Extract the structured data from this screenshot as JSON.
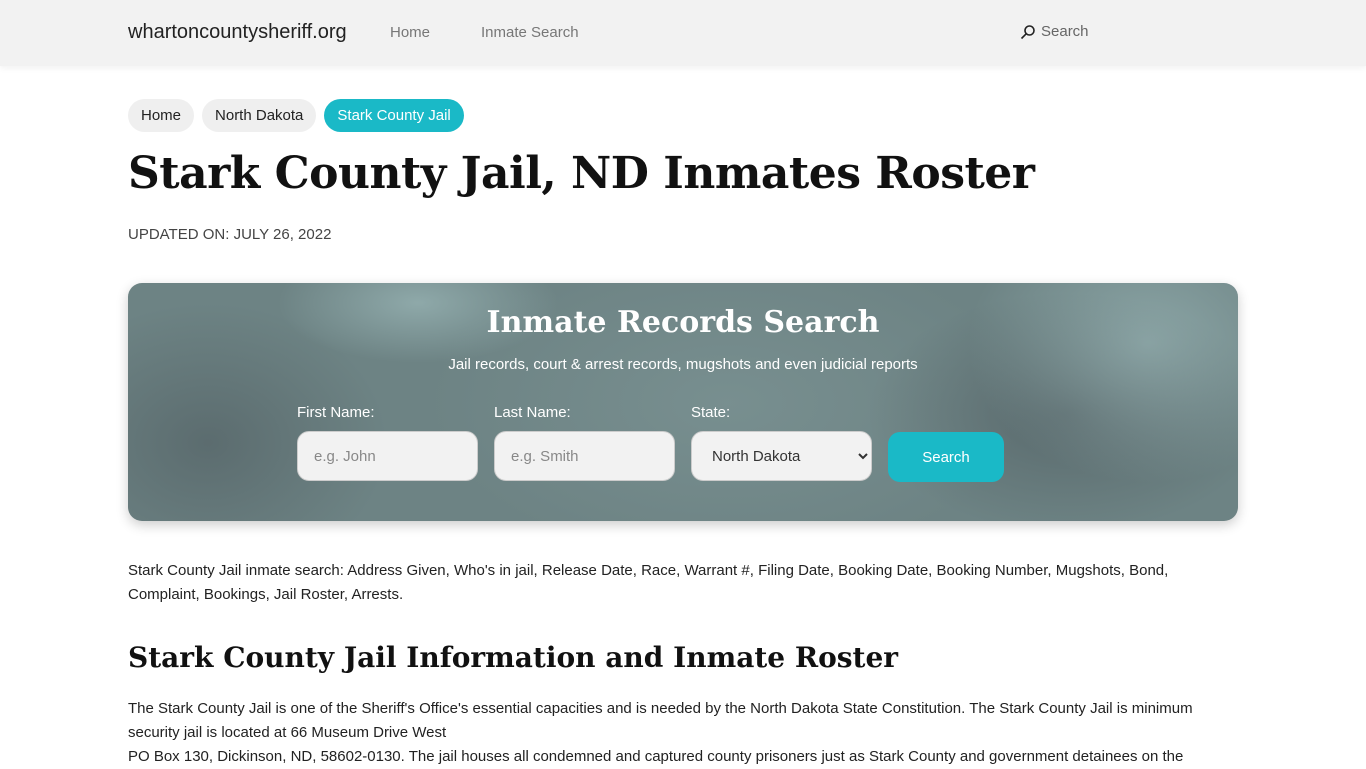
{
  "nav": {
    "brand": "whartoncountysheriff.org",
    "links": [
      "Home",
      "Inmate Search"
    ],
    "search_label": "Search",
    "search_icon": "search-icon"
  },
  "breadcrumb": [
    "Home",
    "North Dakota",
    "Stark County Jail"
  ],
  "page": {
    "title": "Stark County Jail, ND Inmates Roster",
    "updated": "UPDATED ON: JULY 26, 2022"
  },
  "hero": {
    "title": "Inmate Records Search",
    "subtitle": "Jail records, court & arrest records, mugshots and even judicial reports",
    "first_name_label": "First Name:",
    "first_name_placeholder": "e.g. John",
    "last_name_label": "Last Name:",
    "last_name_placeholder": "e.g. Smith",
    "state_label": "State:",
    "state_selected": "North Dakota",
    "search_button": "Search"
  },
  "content": {
    "intro": "Stark County Jail inmate search: Address Given, Who's in jail, Release Date, Race, Warrant #, Filing Date, Booking Date, Booking Number, Mugshots, Bond, Complaint, Bookings, Jail Roster, Arrests.",
    "section_title": "Stark County Jail Information and Inmate Roster",
    "section_line1": "The Stark County Jail is one of the Sheriff's Office's essential capacities and is needed by the North Dakota State Constitution. The Stark County Jail is minimum security jail is located at 66 Museum Drive West",
    "section_line2": "PO Box 130, Dickinson, ND, 58602-0130. The jail houses all condemned and captured county prisoners just as Stark County and government detainees on the"
  }
}
